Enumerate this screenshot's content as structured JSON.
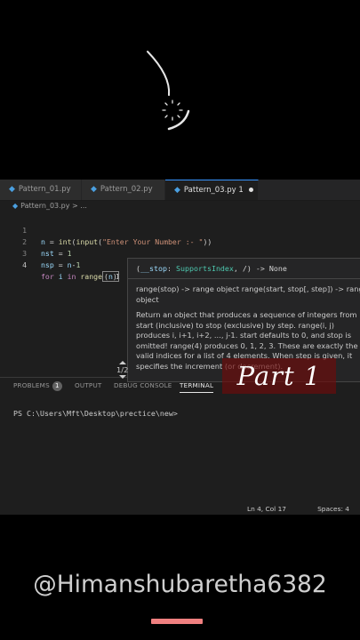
{
  "tabs": [
    {
      "label": "Pattern_01.py",
      "active": false
    },
    {
      "label": "Pattern_02.py",
      "active": false
    },
    {
      "label": "Pattern_03.py 1",
      "active": true
    }
  ],
  "breadcrumb": {
    "file": "Pattern_03.py",
    "sep": ">",
    "ellipsis": "..."
  },
  "code": {
    "line_numbers": [
      "1",
      "2",
      "3",
      "4"
    ],
    "line1": {
      "var": "n",
      "eq": " = ",
      "fn1": "int",
      "lp1": "(",
      "fn2": "input",
      "lp2": "(",
      "str": "\"Enter Your Number :- \"",
      "rp": "))"
    },
    "line2": {
      "var": "nst",
      "eq": " = ",
      "num": "1"
    },
    "line3": {
      "var": "nsp",
      "eq": " = ",
      "var2": "n",
      "op": "-",
      "num": "1"
    },
    "line4": {
      "kw1": "for",
      "var": " i ",
      "kw2": "in",
      "fn": " range",
      "lp": "(",
      "arg": "n",
      "rp": ")"
    }
  },
  "hover": {
    "sig_open": "(",
    "param": "__stop",
    "colon": ": ",
    "type": "SupportsIndex",
    "sig_rest": ", /) -> None",
    "doc1": "range(stop) -> range object range(start, stop[, step]) -> range object",
    "doc2": "Return an object that produces a sequence of integers from start (inclusive) to stop (exclusive) by step. range(i, j) produces i, i+1, i+2, ..., j-1. start defaults to 0, and stop is omitted! range(4) produces 0, 1, 2, 3. These are exactly the valid indices for a list of 4 elements. When step is given, it specifies the increment (or decrement).",
    "counter": "1/2"
  },
  "panel": {
    "problems": "PROBLEMS",
    "problems_count": "1",
    "output": "OUTPUT",
    "debug": "DEBUG CONSOLE",
    "terminal": "TERMINAL",
    "prompt": "PS C:\\Users\\Mft\\Desktop\\precticе\\new>"
  },
  "status": {
    "position": "Ln 4, Col 17",
    "spaces": "Spaces: 4"
  },
  "overlay": {
    "part": "Part 1",
    "handle": "@Himanshubaretha6382"
  },
  "colors": {
    "accent": "#3794ff",
    "part_bg": "#6e0a0a",
    "home_bar": "#f08080"
  }
}
